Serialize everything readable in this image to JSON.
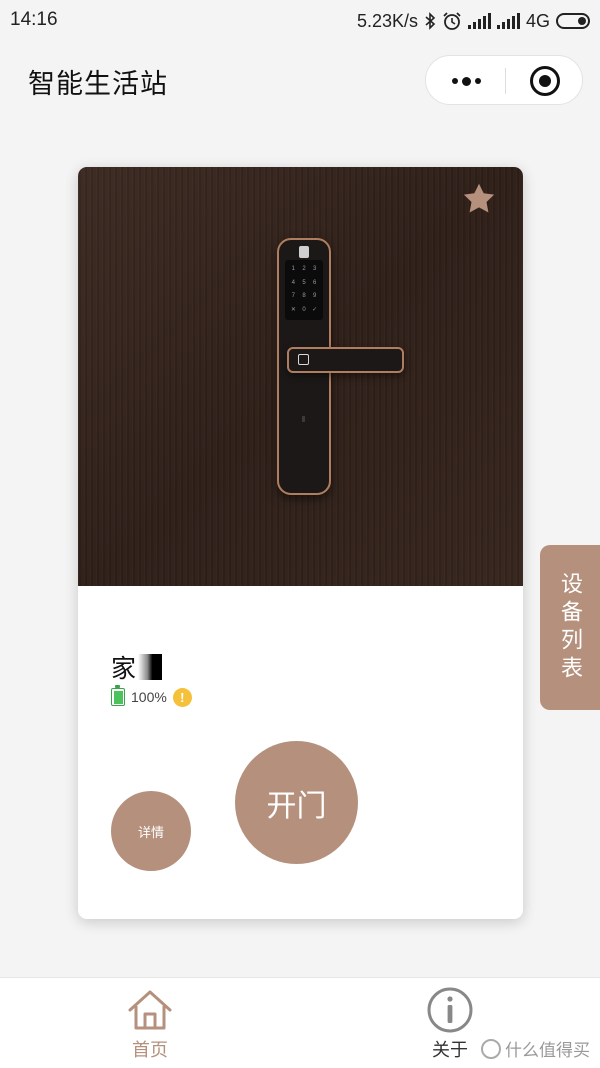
{
  "status_bar": {
    "time": "14:16",
    "net_speed": "5.23K/s",
    "network_type": "4G",
    "icons": [
      "bluetooth-icon",
      "alarm-icon",
      "signal-icon",
      "signal-icon",
      "battery-icon"
    ]
  },
  "header": {
    "title": "智能生活站",
    "more_icon": "more-dots-icon",
    "close_icon": "close-circle-icon"
  },
  "card": {
    "favorite_icon": "star-icon",
    "device_name": "家",
    "battery_percent": "100%",
    "warning_icon": "warning-icon",
    "detail_label": "详情",
    "open_label": "开门",
    "keypad_keys": [
      "1",
      "2",
      "3",
      "4",
      "5",
      "6",
      "7",
      "8",
      "9",
      "✕",
      "0",
      "✓"
    ]
  },
  "side_tab": {
    "label": "设备列表"
  },
  "tab_bar": {
    "items": [
      {
        "label": "首页",
        "icon": "home-icon",
        "active": true
      },
      {
        "label": "关于",
        "icon": "info-icon",
        "active": false
      }
    ]
  },
  "watermark": {
    "text": "什么值得买"
  },
  "colors": {
    "accent": "#b5907c",
    "door": "#33241c",
    "background": "#f4f4f4"
  }
}
